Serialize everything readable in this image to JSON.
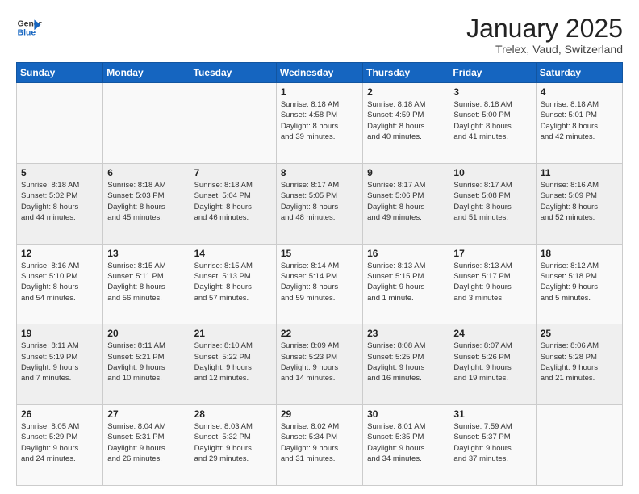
{
  "header": {
    "logo_general": "General",
    "logo_blue": "Blue",
    "title": "January 2025",
    "subtitle": "Trelex, Vaud, Switzerland"
  },
  "days_of_week": [
    "Sunday",
    "Monday",
    "Tuesday",
    "Wednesday",
    "Thursday",
    "Friday",
    "Saturday"
  ],
  "weeks": [
    [
      {
        "day": "",
        "info": ""
      },
      {
        "day": "",
        "info": ""
      },
      {
        "day": "",
        "info": ""
      },
      {
        "day": "1",
        "info": "Sunrise: 8:18 AM\nSunset: 4:58 PM\nDaylight: 8 hours\nand 39 minutes."
      },
      {
        "day": "2",
        "info": "Sunrise: 8:18 AM\nSunset: 4:59 PM\nDaylight: 8 hours\nand 40 minutes."
      },
      {
        "day": "3",
        "info": "Sunrise: 8:18 AM\nSunset: 5:00 PM\nDaylight: 8 hours\nand 41 minutes."
      },
      {
        "day": "4",
        "info": "Sunrise: 8:18 AM\nSunset: 5:01 PM\nDaylight: 8 hours\nand 42 minutes."
      }
    ],
    [
      {
        "day": "5",
        "info": "Sunrise: 8:18 AM\nSunset: 5:02 PM\nDaylight: 8 hours\nand 44 minutes."
      },
      {
        "day": "6",
        "info": "Sunrise: 8:18 AM\nSunset: 5:03 PM\nDaylight: 8 hours\nand 45 minutes."
      },
      {
        "day": "7",
        "info": "Sunrise: 8:18 AM\nSunset: 5:04 PM\nDaylight: 8 hours\nand 46 minutes."
      },
      {
        "day": "8",
        "info": "Sunrise: 8:17 AM\nSunset: 5:05 PM\nDaylight: 8 hours\nand 48 minutes."
      },
      {
        "day": "9",
        "info": "Sunrise: 8:17 AM\nSunset: 5:06 PM\nDaylight: 8 hours\nand 49 minutes."
      },
      {
        "day": "10",
        "info": "Sunrise: 8:17 AM\nSunset: 5:08 PM\nDaylight: 8 hours\nand 51 minutes."
      },
      {
        "day": "11",
        "info": "Sunrise: 8:16 AM\nSunset: 5:09 PM\nDaylight: 8 hours\nand 52 minutes."
      }
    ],
    [
      {
        "day": "12",
        "info": "Sunrise: 8:16 AM\nSunset: 5:10 PM\nDaylight: 8 hours\nand 54 minutes."
      },
      {
        "day": "13",
        "info": "Sunrise: 8:15 AM\nSunset: 5:11 PM\nDaylight: 8 hours\nand 56 minutes."
      },
      {
        "day": "14",
        "info": "Sunrise: 8:15 AM\nSunset: 5:13 PM\nDaylight: 8 hours\nand 57 minutes."
      },
      {
        "day": "15",
        "info": "Sunrise: 8:14 AM\nSunset: 5:14 PM\nDaylight: 8 hours\nand 59 minutes."
      },
      {
        "day": "16",
        "info": "Sunrise: 8:13 AM\nSunset: 5:15 PM\nDaylight: 9 hours\nand 1 minute."
      },
      {
        "day": "17",
        "info": "Sunrise: 8:13 AM\nSunset: 5:17 PM\nDaylight: 9 hours\nand 3 minutes."
      },
      {
        "day": "18",
        "info": "Sunrise: 8:12 AM\nSunset: 5:18 PM\nDaylight: 9 hours\nand 5 minutes."
      }
    ],
    [
      {
        "day": "19",
        "info": "Sunrise: 8:11 AM\nSunset: 5:19 PM\nDaylight: 9 hours\nand 7 minutes."
      },
      {
        "day": "20",
        "info": "Sunrise: 8:11 AM\nSunset: 5:21 PM\nDaylight: 9 hours\nand 10 minutes."
      },
      {
        "day": "21",
        "info": "Sunrise: 8:10 AM\nSunset: 5:22 PM\nDaylight: 9 hours\nand 12 minutes."
      },
      {
        "day": "22",
        "info": "Sunrise: 8:09 AM\nSunset: 5:23 PM\nDaylight: 9 hours\nand 14 minutes."
      },
      {
        "day": "23",
        "info": "Sunrise: 8:08 AM\nSunset: 5:25 PM\nDaylight: 9 hours\nand 16 minutes."
      },
      {
        "day": "24",
        "info": "Sunrise: 8:07 AM\nSunset: 5:26 PM\nDaylight: 9 hours\nand 19 minutes."
      },
      {
        "day": "25",
        "info": "Sunrise: 8:06 AM\nSunset: 5:28 PM\nDaylight: 9 hours\nand 21 minutes."
      }
    ],
    [
      {
        "day": "26",
        "info": "Sunrise: 8:05 AM\nSunset: 5:29 PM\nDaylight: 9 hours\nand 24 minutes."
      },
      {
        "day": "27",
        "info": "Sunrise: 8:04 AM\nSunset: 5:31 PM\nDaylight: 9 hours\nand 26 minutes."
      },
      {
        "day": "28",
        "info": "Sunrise: 8:03 AM\nSunset: 5:32 PM\nDaylight: 9 hours\nand 29 minutes."
      },
      {
        "day": "29",
        "info": "Sunrise: 8:02 AM\nSunset: 5:34 PM\nDaylight: 9 hours\nand 31 minutes."
      },
      {
        "day": "30",
        "info": "Sunrise: 8:01 AM\nSunset: 5:35 PM\nDaylight: 9 hours\nand 34 minutes."
      },
      {
        "day": "31",
        "info": "Sunrise: 7:59 AM\nSunset: 5:37 PM\nDaylight: 9 hours\nand 37 minutes."
      },
      {
        "day": "",
        "info": ""
      }
    ]
  ]
}
